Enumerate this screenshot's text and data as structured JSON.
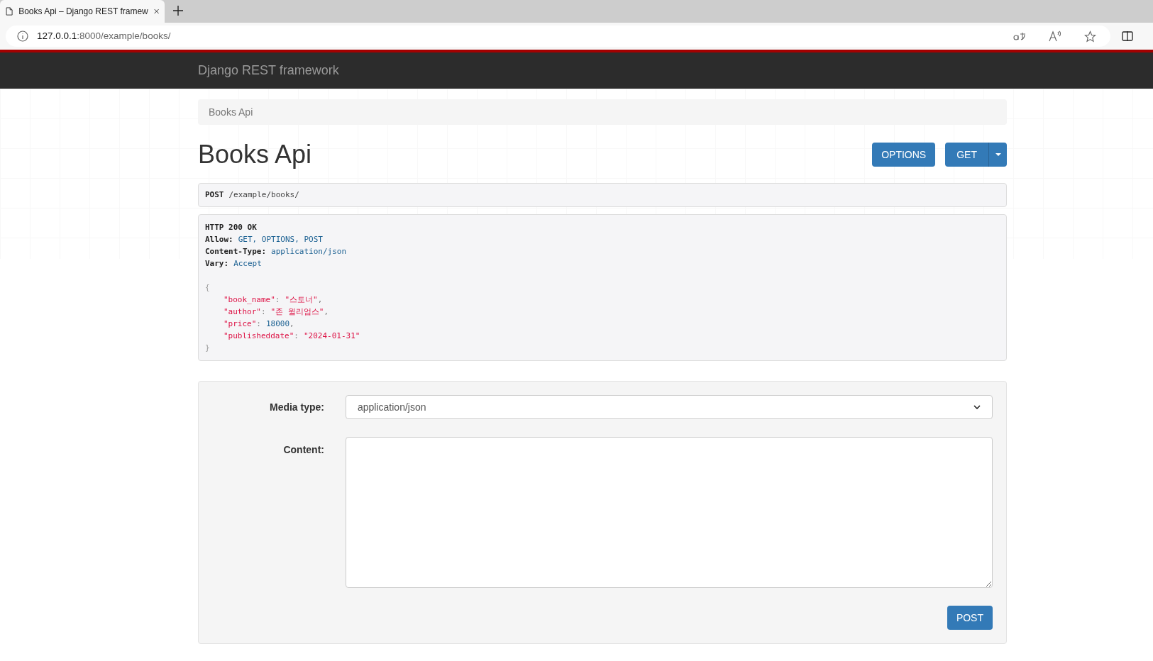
{
  "browser": {
    "tab_title": "Books Api – Django REST framew",
    "url_host": "127.0.0.1",
    "url_rest": ":8000/example/books/"
  },
  "navbar": {
    "brand": "Django REST framework"
  },
  "breadcrumb": [
    {
      "label": "Books Api",
      "selected": true
    }
  ],
  "page_title": "Books Api",
  "action_buttons": [
    {
      "label": "OPTIONS",
      "kind": "plain"
    },
    {
      "label": "GET",
      "kind": "split"
    }
  ],
  "request": {
    "method": "POST",
    "path": "/example/books/"
  },
  "response": {
    "status": "HTTP 200 OK",
    "headers": [
      {
        "name": "Allow:",
        "value": "GET, OPTIONS, POST"
      },
      {
        "name": "Content-Type:",
        "value": "application/json"
      },
      {
        "name": "Vary:",
        "value": "Accept"
      }
    ],
    "open": "{",
    "close": "}",
    "fields": [
      {
        "key": "\"book_name\"",
        "colon": ":",
        "value": "\"스토너\"",
        "kind": "string",
        "comma": ","
      },
      {
        "key": "\"author\"",
        "colon": ":",
        "value": "\"존 윌리엄스\"",
        "kind": "string",
        "comma": ","
      },
      {
        "key": "\"price\"",
        "colon": ":",
        "value": "18000",
        "kind": "number",
        "comma": ","
      },
      {
        "key": "\"publisheddate\"",
        "colon": ":",
        "value": "\"2024-01-31\"",
        "kind": "string"
      }
    ]
  },
  "form": {
    "media_label": "Media type:",
    "media_value": "application/json",
    "content_label": "Content:",
    "submit": "POST"
  }
}
